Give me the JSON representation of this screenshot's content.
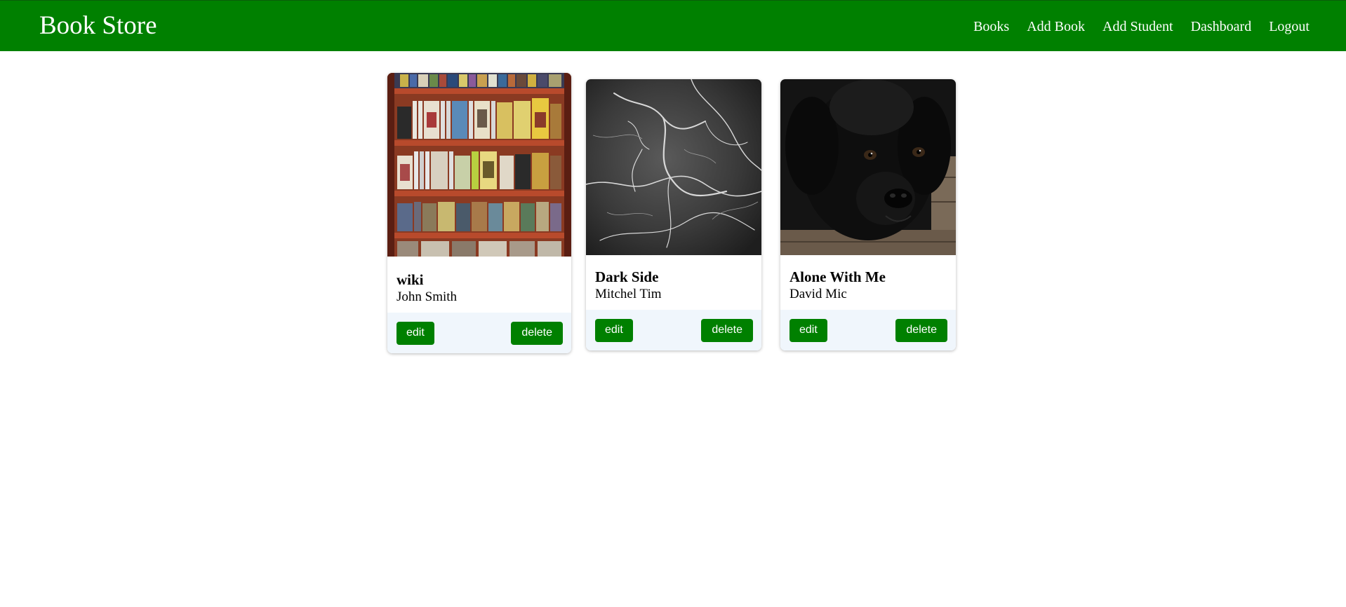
{
  "header": {
    "brand": "Book Store",
    "nav": [
      "Books",
      "Add Book",
      "Add Student",
      "Dashboard",
      "Logout"
    ],
    "background_color": "#008000"
  },
  "books": [
    {
      "title": "wiki",
      "author": "John Smith",
      "edit_label": "edit",
      "delete_label": "delete",
      "image": "bookshelf-photo"
    },
    {
      "title": "Dark Side",
      "author": "Mitchel Tim",
      "edit_label": "edit",
      "delete_label": "delete",
      "image": "dark-marble-photo"
    },
    {
      "title": "Alone With Me",
      "author": "David Mic",
      "edit_label": "edit",
      "delete_label": "delete",
      "image": "black-puppy-photo"
    }
  ],
  "colors": {
    "accent": "#008000",
    "card_footer": "#f0f6fc"
  }
}
